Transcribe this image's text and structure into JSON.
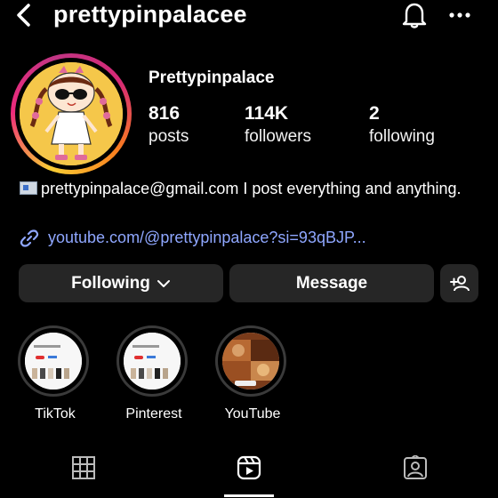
{
  "header": {
    "username": "prettypinpalacee"
  },
  "profile": {
    "display_name": "Prettypinpalace",
    "stats": [
      {
        "value": "816",
        "label": "posts"
      },
      {
        "value": "114K",
        "label": "followers"
      },
      {
        "value": "2",
        "label": "following"
      }
    ],
    "bio": "prettypinpalace@gmail.com I post everything and anything.",
    "link": "youtube.com/@prettypinpalace?si=93qBJP..."
  },
  "actions": {
    "following_label": "Following",
    "message_label": "Message"
  },
  "highlights": [
    {
      "label": "TikTok"
    },
    {
      "label": "Pinterest"
    },
    {
      "label": "YouTube"
    }
  ],
  "tabs": [
    "grid-icon",
    "reels-icon",
    "tagged-icon"
  ],
  "colors": {
    "background": "#000000",
    "button": "#262626",
    "link": "#8fa7ff"
  }
}
